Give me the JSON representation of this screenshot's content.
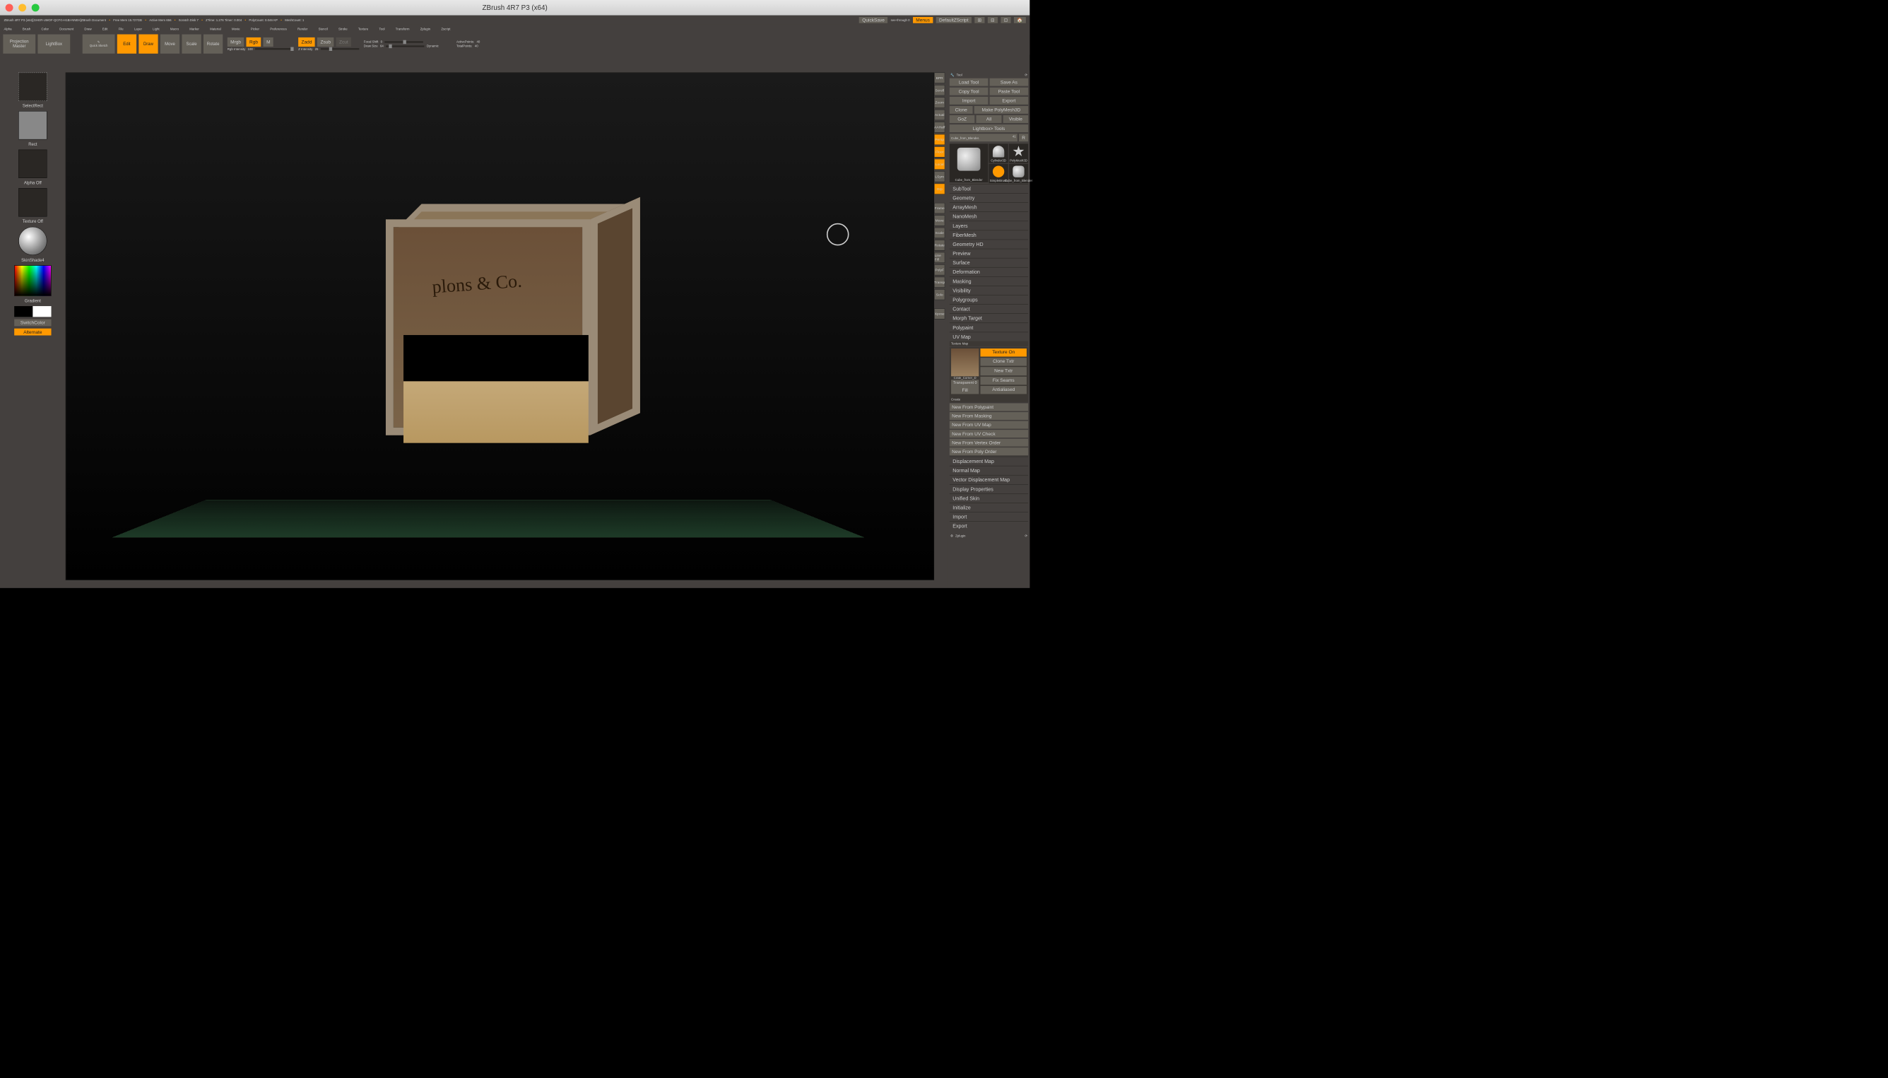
{
  "window": {
    "title": "ZBrush 4R7 P3 (x64)"
  },
  "statusbar": {
    "project": "ZBrush 4R7 P3 (x64)[GHER-UMOF-QCFG-H1BI-NNEH]ZBrush Document",
    "free_mem": "Free Mem 15.727GB",
    "active_mem": "Active Mem 656",
    "scratch": "Scratch Disk 7",
    "ztime": "ZTime: 1.276  Timer: 0.004",
    "polycount": "PolyCount: 0.046 KP",
    "meshcount": "MeshCount: 1",
    "quicksave": "QuickSave",
    "seethrough": "see-through 0",
    "menus": "Menus",
    "script": "DefaultZScript"
  },
  "menu": [
    "Alpha",
    "Brush",
    "Color",
    "Document",
    "Draw",
    "Edit",
    "File",
    "Layer",
    "Light",
    "Macro",
    "Marker",
    "Material",
    "Movie",
    "Picker",
    "Preferences",
    "Render",
    "Stencil",
    "Stroke",
    "Texture",
    "Tool",
    "Transform",
    "Zplugin",
    "Zscript"
  ],
  "toolbar": {
    "projection": "Projection Master",
    "lightbox": "LightBox",
    "quicksketch": "Quick Sketch",
    "edit": "Edit",
    "draw": "Draw",
    "move": "Move",
    "scale": "Scale",
    "rotate": "Rotate",
    "mrgb": "Mrgb",
    "rgb": "Rgb",
    "m": "M",
    "rgb_intensity_label": "Rgb Intensity",
    "rgb_intensity_val": "100",
    "zadd": "Zadd",
    "zsub": "Zsub",
    "zcut": "Zcut",
    "z_intensity_label": "Z Intensity",
    "z_intensity_val": "25",
    "focal_shift_label": "Focal Shift",
    "focal_shift_val": "0",
    "draw_size_label": "Draw Size",
    "draw_size_val": "64",
    "dynamic": "Dynamic",
    "active_points_label": "ActivePoints:",
    "active_points_val": "40",
    "total_points_label": "TotalPoints:",
    "total_points_val": "40"
  },
  "left": {
    "brush": "SelectRect",
    "stroke": "Rect",
    "alpha": "Alpha Off",
    "texture": "Texture Off",
    "material": "SkinShade4",
    "gradient": "Gradient",
    "switch": "SwitchColor",
    "alternate": "Alternate"
  },
  "vp_icons": [
    "BPR",
    "Scroll",
    "Zoom",
    "Actual",
    "AAHalf",
    "Persp",
    "Floor",
    "Local",
    "LSym",
    "Grp",
    "",
    "Frame",
    "Move",
    "Scale",
    "Rotate",
    "Line Fill",
    "PolyF",
    "Transp",
    "Solo",
    "",
    "Xpose"
  ],
  "vp_orange_idx": [
    5,
    6,
    7,
    9
  ],
  "right": {
    "header": "Tool",
    "load": "Load Tool",
    "saveas": "Save As",
    "copy": "Copy Tool",
    "paste": "Paste Tool",
    "import": "Import",
    "export": "Export",
    "clone": "Clone",
    "make": "Make PolyMesh3D",
    "goz": "GoZ",
    "all": "All",
    "visible": "Visible",
    "lightbox": "Lightbox> Tools",
    "current": "Cube_from_Blender.",
    "current_n": "41",
    "r": "R",
    "tiles": [
      "Cube_from_Blender",
      "Cylinder3D",
      "PolyMesh3D",
      "SimpleBrush",
      "Cube_from_Blender"
    ],
    "accordion": [
      "SubTool",
      "Geometry",
      "ArrayMesh",
      "NanoMesh",
      "Layers",
      "FiberMesh",
      "Geometry HD",
      "Preview",
      "Surface",
      "Deformation",
      "Masking",
      "Visibility",
      "Polygroups",
      "Contact",
      "Morph Target",
      "Polypaint",
      "UV Map"
    ],
    "texmap": {
      "header": "Texture Map",
      "texture_on": "Texture On",
      "clone": "Clone Txtr",
      "new": "New Txtr",
      "fix": "Fix Seams",
      "anti": "Antialiased",
      "thumb_label": "Crate_Corner_D",
      "transparent": "Transparent 0",
      "fill": "Fill"
    },
    "create_header": "Create",
    "create": [
      "New From Polypaint",
      "New From Masking",
      "New From UV Map",
      "New From UV Check",
      "New From Vertex Order",
      "New From Poly Order"
    ],
    "accordion2": [
      "Displacement Map",
      "Normal Map",
      "Vector Displacement Map",
      "Display Properties",
      "Unified Skin",
      "Initialize",
      "Import",
      "Export"
    ],
    "zplugin": "Zplugin"
  }
}
